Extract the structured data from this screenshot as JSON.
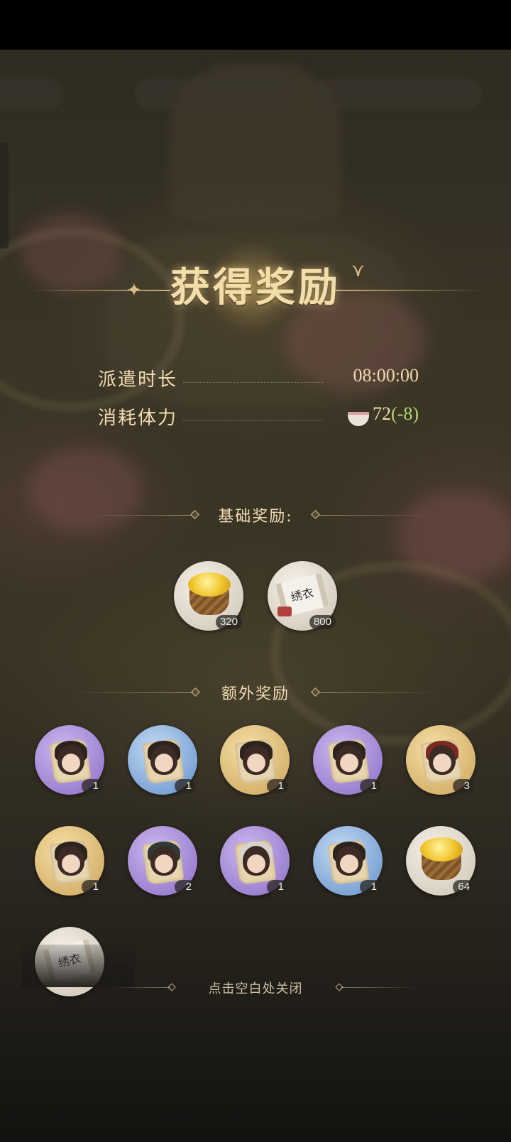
{
  "title": "获得奖励",
  "stats": [
    {
      "label": "派遣时长",
      "value": "08:00:00"
    },
    {
      "label": "消耗体力",
      "value": "72",
      "delta": "(-8)",
      "icon": "stamina-bowl-icon"
    }
  ],
  "base_rewards": {
    "header": "基础奖励:",
    "items": [
      {
        "kind": "gold-coins-icon",
        "count": "320"
      },
      {
        "kind": "embroidered-scroll-icon",
        "scroll_text": "绣衣",
        "count": "800"
      }
    ]
  },
  "extra_rewards": {
    "header": "额外奖励",
    "items": [
      {
        "kind": "character-fragment-icon",
        "bg": "purple",
        "count": "1"
      },
      {
        "kind": "character-fragment-icon",
        "bg": "blue",
        "count": "1"
      },
      {
        "kind": "character-fragment-icon",
        "bg": "gold",
        "count": "1"
      },
      {
        "kind": "character-fragment-icon",
        "bg": "purple",
        "count": "1"
      },
      {
        "kind": "character-fragment-icon",
        "bg": "gold",
        "count": "3"
      },
      {
        "kind": "character-fragment-icon",
        "bg": "gold",
        "count": "1"
      },
      {
        "kind": "character-fragment-icon",
        "bg": "purple",
        "count": "2"
      },
      {
        "kind": "character-fragment-icon",
        "bg": "purple",
        "count": "1"
      },
      {
        "kind": "character-fragment-icon",
        "bg": "blue",
        "count": "1"
      },
      {
        "kind": "gold-coins-icon",
        "bg": "white",
        "count": "64"
      },
      {
        "kind": "embroidered-scroll-icon",
        "bg": "white",
        "scroll_text": "绣衣"
      }
    ]
  },
  "close_hint": "点击空白处关闭"
}
